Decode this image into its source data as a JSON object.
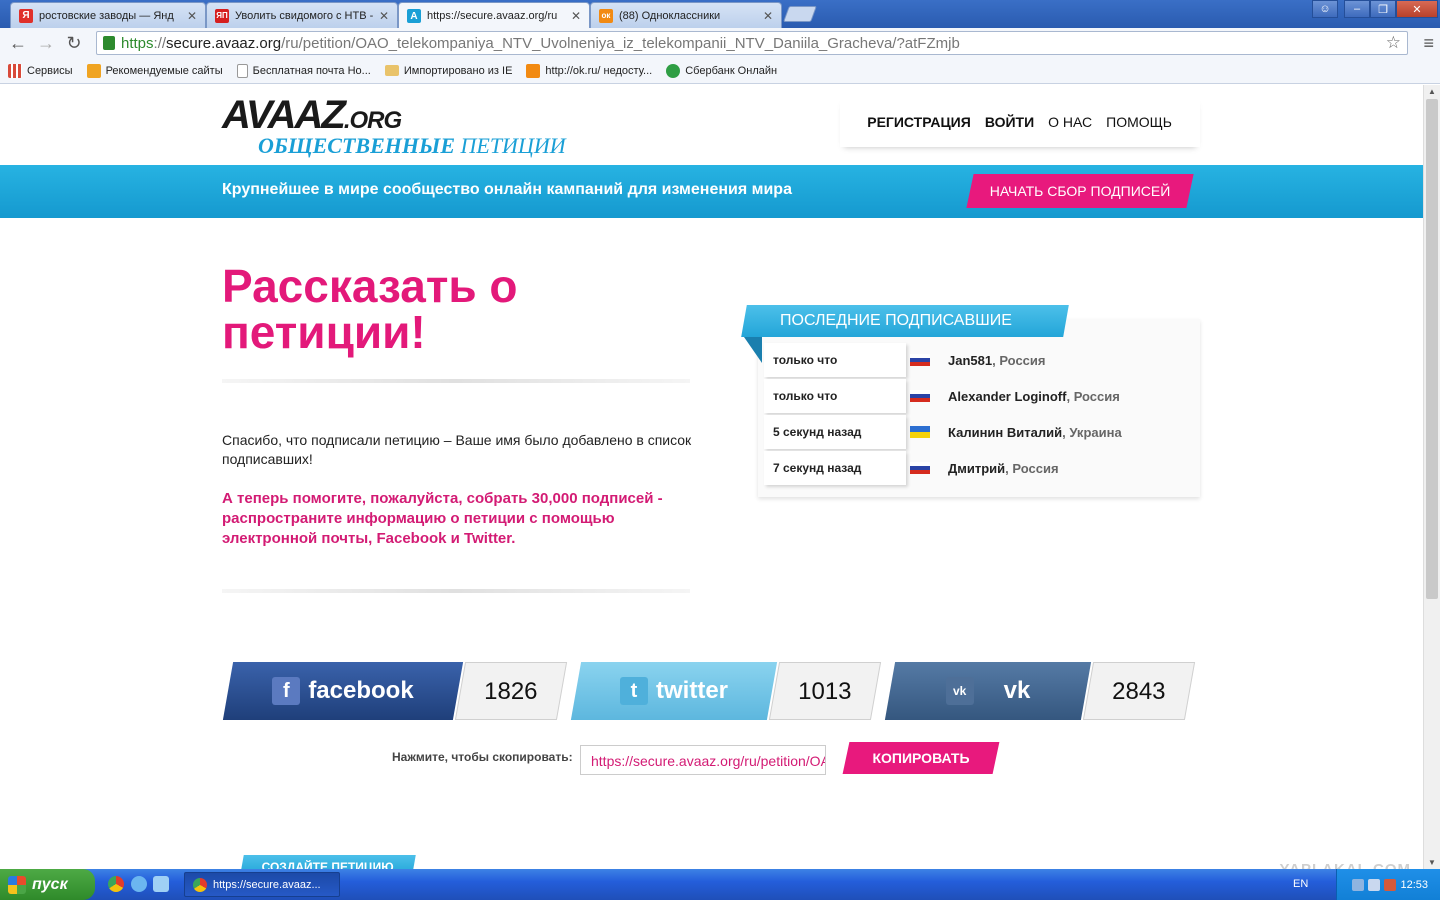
{
  "browser": {
    "tabs": [
      {
        "label": "ростовские заводы — Янд",
        "favicon": "yandex-icon",
        "color": "#e0302a",
        "glyph": "Я"
      },
      {
        "label": "Уволить свидомого с НТВ -",
        "favicon": "yaplakal-icon",
        "color": "#d61f1f",
        "glyph": "ЯП"
      },
      {
        "label": "https://secure.avaaz.org/ru",
        "favicon": "avaaz-icon",
        "color": "#1a9fd6",
        "glyph": "A",
        "active": true
      },
      {
        "label": "(88) Одноклассники",
        "favicon": "odnoklassniki-icon",
        "color": "#f28a12",
        "glyph": "ок"
      }
    ],
    "url": {
      "scheme": "https",
      "sep": "://",
      "host": "secure.avaaz.org",
      "path": "/ru/petition/OAO_telekompaniya_NTV_Uvolneniya_iz_telekompanii_NTV_Daniila_Gracheva/?atFZmjb"
    },
    "bookmarks": [
      {
        "label": "Сервисы",
        "icon": "apps-grid-icon",
        "color": "#d84a3a"
      },
      {
        "label": "Рекомендуемые сайты",
        "icon": "bing-icon",
        "color": "#f0a422"
      },
      {
        "label": "Бесплатная почта Но...",
        "icon": "page-icon",
        "color": "#e8e8e8"
      },
      {
        "label": "Импортировано из IE",
        "icon": "folder-icon",
        "color": "#e9c36a"
      },
      {
        "label": "http://ok.ru/ недосту...",
        "icon": "odnoklassniki-icon",
        "color": "#f28a12"
      },
      {
        "label": "Сбербанк Онлайн",
        "icon": "sberbank-icon",
        "color": "#2f9e44"
      }
    ]
  },
  "page": {
    "logo": {
      "main": "AVAAZ",
      "org": ".ORG",
      "sub_bold": "ОБЩЕСТВЕННЫЕ",
      "sub": " ПЕТИЦИИ"
    },
    "nav": [
      {
        "label": "РЕГИСТРАЦИЯ",
        "bold": true
      },
      {
        "label": "ВОЙТИ",
        "bold": true
      },
      {
        "label": "О НАС",
        "bold": false
      },
      {
        "label": "ПОМОЩЬ",
        "bold": false
      }
    ],
    "banner_text": "Крупнейшее в мире сообщество онлайн кампаний для изменения мира",
    "start_button": "НАЧАТЬ СБОР ПОДПИСЕЙ",
    "heading": "Рассказать о петиции!",
    "thanks": "Спасибо, что подписали петицию – Ваше имя было добавлено в список подписавших!",
    "ask": "А теперь помогите, пожалуйста, собрать 30,000 подписей - распространите информацию о петиции с помощью электронной почты, Facebook и Twitter.",
    "signers_title": "ПОСЛЕДНИЕ ПОДПИСАВШИЕ",
    "signers": [
      {
        "time": "только что",
        "name": "Jan581",
        "country": "Россия",
        "flag": "ru"
      },
      {
        "time": "только что",
        "name": "Alexander Loginoff",
        "country": "Россия",
        "flag": "ru"
      },
      {
        "time": "5 секунд назад",
        "name": "Калинин Виталий",
        "country": "Украина",
        "flag": "ua"
      },
      {
        "time": "7 секунд назад",
        "name": "Дмитрий",
        "country": "Россия",
        "flag": "ru"
      }
    ],
    "share": [
      {
        "label": "facebook",
        "count": "1826",
        "color": "#2a4d8f",
        "icon": "facebook-icon",
        "glyph": "f"
      },
      {
        "label": "twitter",
        "count": "1013",
        "color": "#6cc0e3",
        "icon": "twitter-icon",
        "glyph": "t"
      },
      {
        "label": "vk",
        "count": "2843",
        "color": "#3f638f",
        "icon": "vk-icon",
        "glyph": "vk"
      }
    ],
    "copy_label": "Нажмите, чтобы скопировать:",
    "copy_url": "https://secure.avaaz.org/ru/petition/OAO_telekompaniya_NTV",
    "copy_button": "КОПИРОВАТЬ",
    "create_tab": "СОЗДАЙТЕ ПЕТИЦИЮ",
    "watermark": "YAPLAKAL.COM"
  },
  "taskbar": {
    "start": "пуск",
    "item": "https://secure.avaaz...",
    "lang": "EN",
    "time": "12:53"
  },
  "colors": {
    "accent_pink": "#e8197d",
    "accent_blue": "#1a9fd6"
  }
}
